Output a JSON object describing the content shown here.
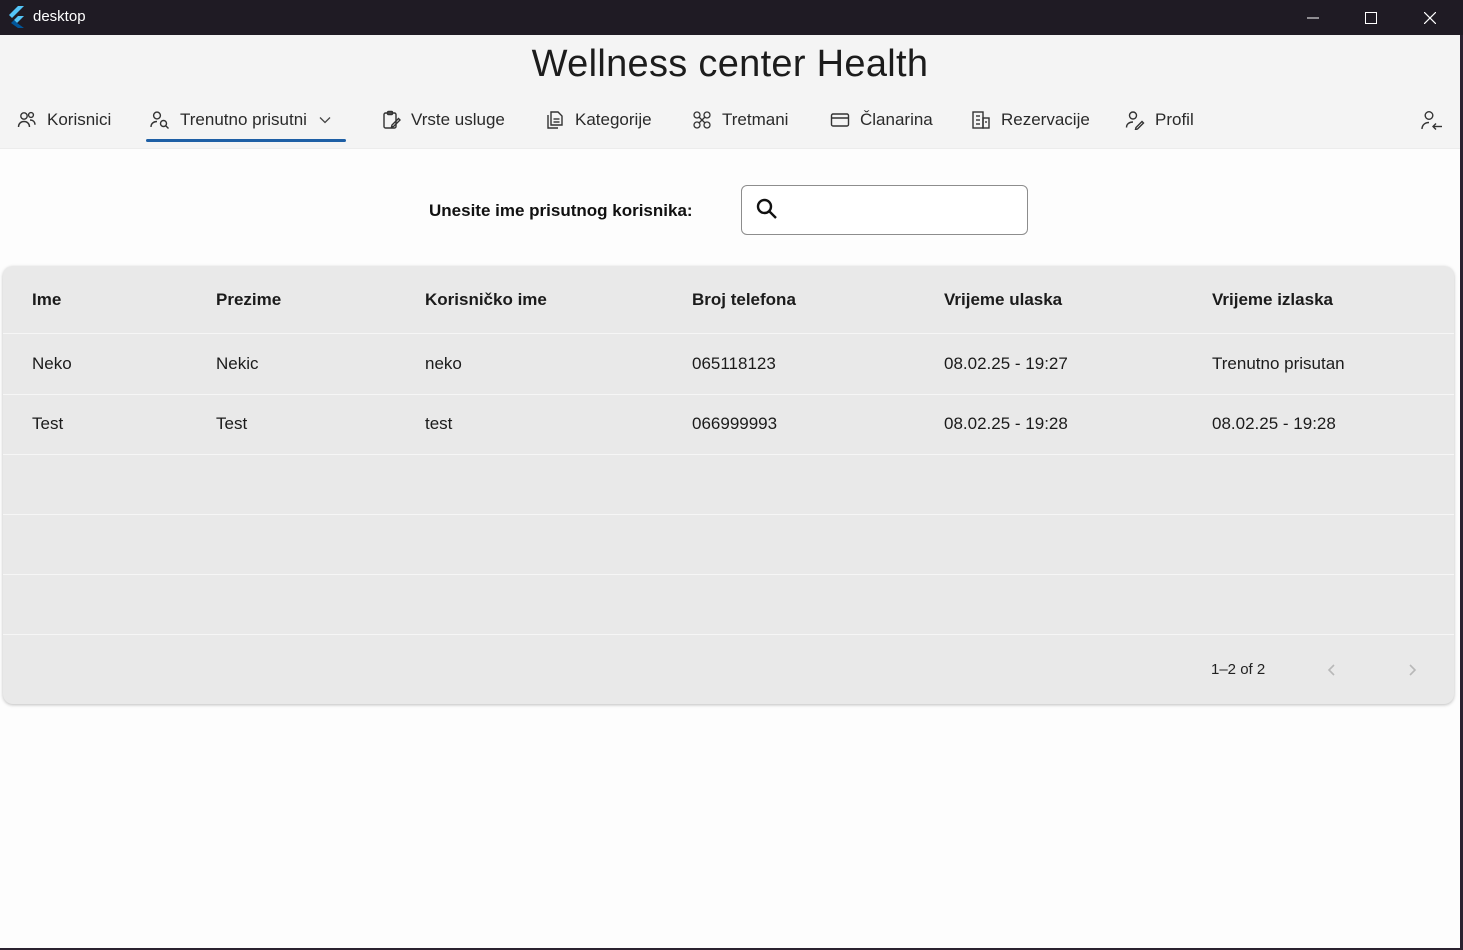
{
  "window": {
    "app_title": "desktop"
  },
  "header": {
    "title": "Wellness center Health",
    "nav": [
      {
        "label": "Korisnici",
        "icon": "users-icon"
      },
      {
        "label": "Trenutno prisutni",
        "icon": "person-search-icon"
      },
      {
        "label": "Vrste usluge",
        "icon": "clipboard-edit-icon"
      },
      {
        "label": "Kategorije",
        "icon": "document-copy-icon"
      },
      {
        "label": "Tretmani",
        "icon": "molecule-icon"
      },
      {
        "label": "Članarina",
        "icon": "card-icon"
      },
      {
        "label": "Rezervacije",
        "icon": "building-icon"
      },
      {
        "label": "Profil",
        "icon": "person-edit-icon"
      }
    ],
    "active_tab": "Trenutno prisutni",
    "accent_color": "#1e5fa5"
  },
  "search": {
    "label": "Unesite ime prisutnog korisnika:",
    "value": "",
    "placeholder": ""
  },
  "table": {
    "columns": [
      "Ime",
      "Prezime",
      "Korisničko ime",
      "Broj telefona",
      "Vrijeme ulaska",
      "Vrijeme izlaska"
    ],
    "rows": [
      [
        "Neko",
        "Nekic",
        "neko",
        "065118123",
        "08.02.25 - 19:27",
        "Trenutno prisutan"
      ],
      [
        "Test",
        "Test",
        "test",
        "066999993",
        "08.02.25 - 19:28",
        "08.02.25 - 19:28"
      ]
    ]
  },
  "pagination": {
    "range_text": "1–2 of 2"
  }
}
